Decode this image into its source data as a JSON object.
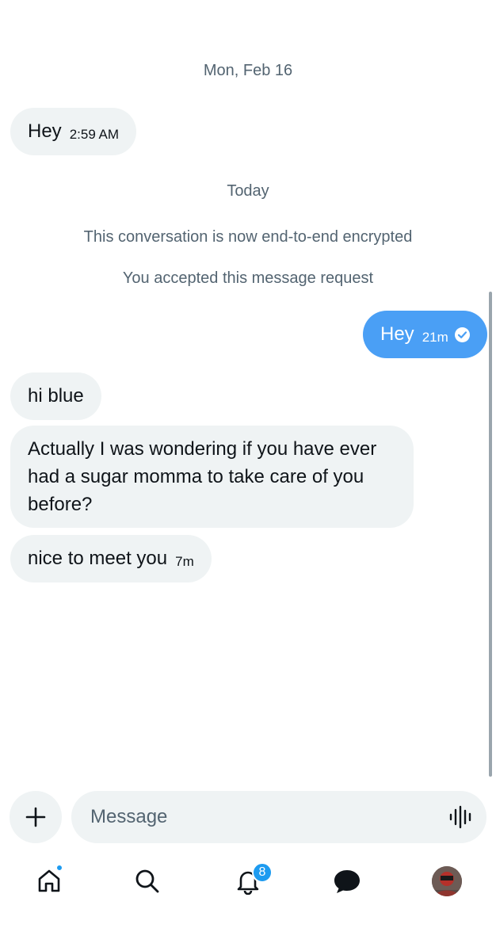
{
  "conversation": {
    "date_separator_1": "Mon, Feb 16",
    "date_separator_2": "Today",
    "system_messages": [
      "This conversation is now end-to-end encrypted",
      "You accepted this message request"
    ],
    "messages": [
      {
        "direction": "incoming",
        "text": "Hey",
        "time": "2:59 AM"
      },
      {
        "direction": "outgoing",
        "text": "Hey",
        "time": "21m",
        "status": "read"
      },
      {
        "direction": "incoming",
        "text": "hi blue",
        "time": ""
      },
      {
        "direction": "incoming",
        "text_lines": [
          "Actually I was wondering if you have ever",
          "had a sugar momma to take care of you",
          "before?"
        ],
        "time": ""
      },
      {
        "direction": "incoming",
        "text": "nice to meet you",
        "time": "7m"
      }
    ]
  },
  "composer": {
    "placeholder": "Message",
    "add_icon": "plus-icon",
    "voice_icon": "voice-waveform-icon"
  },
  "tabbar": {
    "items": [
      "home-icon",
      "search-icon",
      "notifications-bell-icon",
      "messages-bubble-icon",
      "profile-avatar"
    ],
    "notifications_count": "8"
  },
  "colors": {
    "accent": "#1d9bf0",
    "outgoing_bubble": "#4a9ff5",
    "incoming_bubble": "#eff3f4",
    "secondary_text": "#536471"
  }
}
